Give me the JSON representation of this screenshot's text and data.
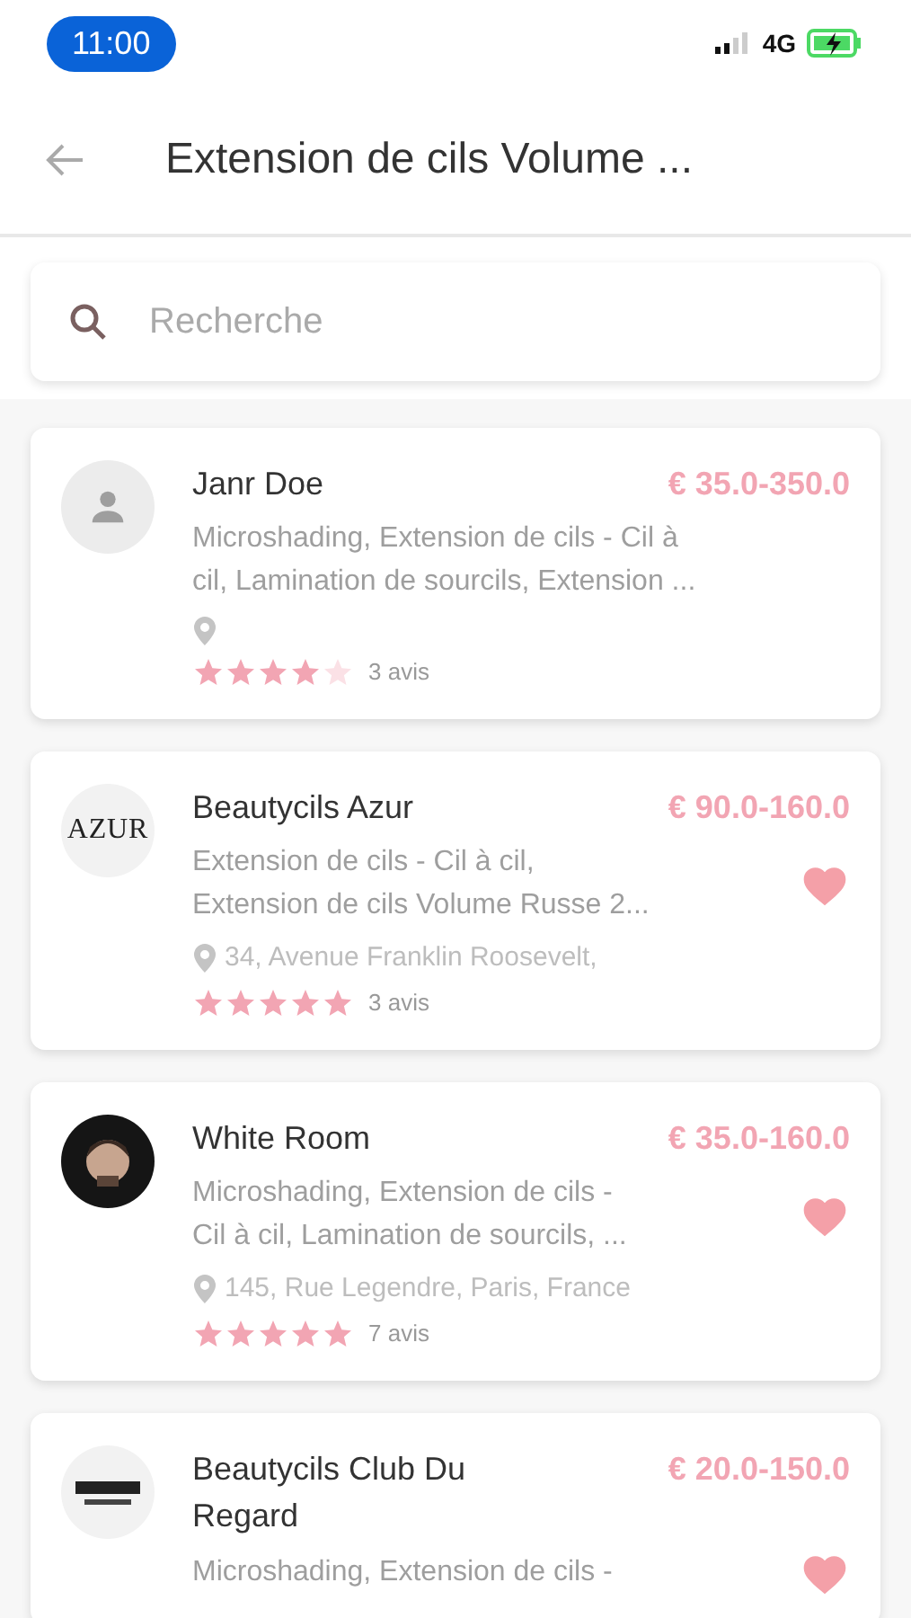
{
  "status_bar": {
    "time": "11:00",
    "network": "4G"
  },
  "header": {
    "title": "Extension de cils Volume ..."
  },
  "search": {
    "placeholder": "Recherche"
  },
  "salons": [
    {
      "name_lines": [
        "Janr Doe"
      ],
      "price": "€ 35.0-350.0",
      "avatar": {
        "kind": "placeholder"
      },
      "services_lines": [
        "Microshading, Extension de cils - Cil à",
        "cil, Lamination de sourcils, Extension ..."
      ],
      "favorite": false,
      "stars": 4,
      "reviews": "3 avis"
    },
    {
      "name_lines": [
        "Beautycils Azur"
      ],
      "price": "€ 90.0-160.0",
      "avatar": {
        "kind": "wordmark",
        "text": "AZUR"
      },
      "services_lines": [
        "Extension de cils - Cil à cil,",
        "Extension de cils Volume Russe 2..."
      ],
      "address": "34, Avenue Franklin Roosevelt,",
      "favorite": true,
      "stars": 5,
      "reviews": "3 avis"
    },
    {
      "name_lines": [
        "White Room"
      ],
      "price": "€ 35.0-160.0",
      "avatar": {
        "kind": "picture"
      },
      "services_lines": [
        "Microshading, Extension de cils -",
        "Cil à cil, Lamination de sourcils, ..."
      ],
      "address": "145, Rue Legendre, Paris, France",
      "favorite": true,
      "stars": 5,
      "reviews": "7 avis"
    },
    {
      "name_lines": [
        "Beautycils Club Du",
        "Regard"
      ],
      "price": "€ 20.0-150.0",
      "avatar": {
        "kind": "logo"
      },
      "services_lines": [
        "Microshading, Extension de cils -"
      ],
      "favorite": true
    }
  ]
}
